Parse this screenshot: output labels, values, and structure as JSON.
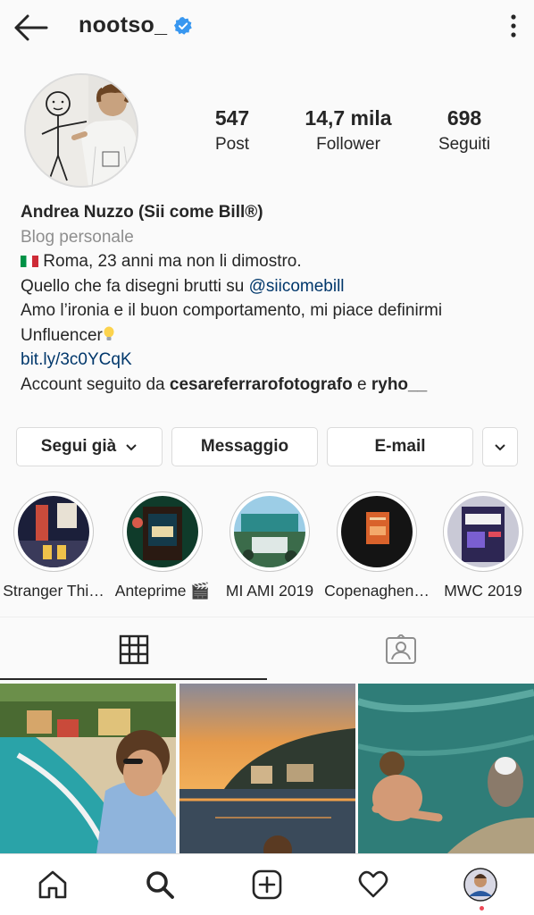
{
  "header": {
    "username": "nootso_",
    "back_icon": "arrow-left-icon",
    "verified_icon": "verified-badge-icon",
    "menu_icon": "more-vertical-icon"
  },
  "stats": [
    {
      "value": "547",
      "label": "Post"
    },
    {
      "value": "14,7 mila",
      "label": "Follower"
    },
    {
      "value": "698",
      "label": "Seguiti"
    }
  ],
  "bio": {
    "name": "Andrea Nuzzo (Sii come Bill®)",
    "category": "Blog personale",
    "line1": "Roma, 23 anni ma non li dimostro.",
    "line2_prefix": "Quello che fa disegni brutti su ",
    "line2_mention": "@siicomebill",
    "line3": "Amo l’ironia e il buon comportamento, mi piace definirmi",
    "line4": "Unfluencer",
    "link": "bit.ly/3c0YCqK",
    "followed_prefix": "Account seguito da ",
    "followed_user1": "cesareferrarofotografo",
    "followed_and": " e ",
    "followed_user2": "ryho__"
  },
  "buttons": {
    "follow": "Segui già",
    "message": "Messaggio",
    "email": "E-mail"
  },
  "highlights": [
    {
      "label": "Stranger Thi…"
    },
    {
      "label": "Anteprime 🎬"
    },
    {
      "label": "MI AMI 2019"
    },
    {
      "label": "Copenaghen…"
    },
    {
      "label": "MWC 2019"
    }
  ],
  "tabs": [
    "grid-icon",
    "tagged-icon"
  ],
  "nav": [
    "home-icon",
    "search-icon",
    "add-post-icon",
    "heart-icon",
    "profile-avatar"
  ],
  "colors": {
    "link": "#00376b",
    "verified": "#3897f0",
    "notification": "#ed4956"
  }
}
